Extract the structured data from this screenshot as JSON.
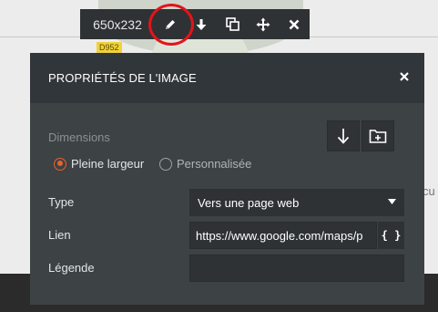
{
  "toolbar": {
    "dimensions": "650x232",
    "buttons": [
      "pencil-icon",
      "arrow-down-icon",
      "duplicate-icon",
      "move-icon",
      "close-icon"
    ]
  },
  "element_tag": "D952",
  "background_text": "cu",
  "dialog": {
    "title": "PROPRIÉTÉS DE L'IMAGE",
    "close_icon": "close-icon",
    "dimensions_label": "Dimensions",
    "download_icon": "download-icon",
    "folder_add_icon": "folder-add-icon",
    "radio_full": "Pleine largeur",
    "radio_custom": "Personnalisée",
    "selected_option": "Pleine largeur",
    "type_label": "Type",
    "type_value": "Vers une page web",
    "link_label": "Lien",
    "link_value": "https://www.google.com/maps/p",
    "dynamic_button": "{ }",
    "caption_label": "Légende",
    "caption_value": ""
  },
  "colors": {
    "accent": "#e8622f",
    "highlight": "#e3141b",
    "dialog_bg": "#3d4245",
    "header_bg": "#31363a"
  }
}
